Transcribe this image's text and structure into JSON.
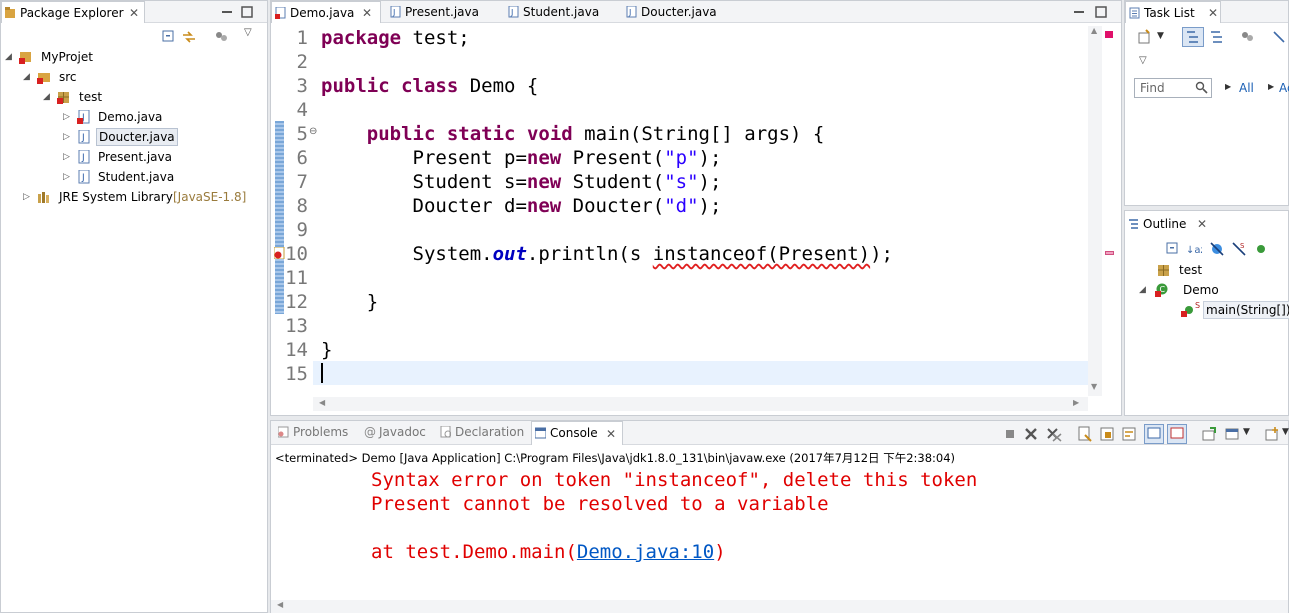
{
  "package_explorer": {
    "title": "Package Explorer",
    "tree": [
      {
        "label": "MyProjet"
      },
      {
        "label": "src"
      },
      {
        "label": "test"
      },
      {
        "label": "Demo.java"
      },
      {
        "label": "Doucter.java"
      },
      {
        "label": "Present.java"
      },
      {
        "label": "Student.java"
      },
      {
        "label": "JRE System Library",
        "suffix": "[JavaSE-1.8]"
      }
    ]
  },
  "editor": {
    "tabs": [
      {
        "label": "Demo.java"
      },
      {
        "label": "Present.java"
      },
      {
        "label": "Student.java"
      },
      {
        "label": "Doucter.java"
      }
    ],
    "line_numbers": [
      "1",
      "2",
      "3",
      "4",
      "5",
      "6",
      "7",
      "8",
      "9",
      "10",
      "11",
      "12",
      "13",
      "14",
      "15"
    ],
    "code": {
      "l1_kw": "package",
      "l1_rest": " test;",
      "l3_kw1": "public",
      "l3_kw2": "class",
      "l3_rest": " Demo {",
      "l5_kw1": "public",
      "l5_kw2": "static",
      "l5_kw3": "void",
      "l5_rest": " main(String[] args) {",
      "l6_a": "Present p=",
      "l6_kw": "new",
      "l6_b": " Present(",
      "l6_str": "\"p\"",
      "l6_c": ");",
      "l7_a": "Student s=",
      "l7_kw": "new",
      "l7_b": " Student(",
      "l7_str": "\"s\"",
      "l7_c": ");",
      "l8_a": "Doucter d=",
      "l8_kw": "new",
      "l8_b": " Doucter(",
      "l8_str": "\"d\"",
      "l8_c": ");",
      "l10_a": "System.",
      "l10_fld": "out",
      "l10_b": ".println(s ",
      "l10_err": "instanceof(Present)",
      "l10_c": ");",
      "l12": "}",
      "l14": "}"
    }
  },
  "task_list": {
    "title": "Task List",
    "find_placeholder": "Find",
    "all_label": "All",
    "activate_label": "Ac"
  },
  "outline": {
    "title": "Outline",
    "items": [
      {
        "label": "test"
      },
      {
        "label": "Demo"
      },
      {
        "label": "main(String[])"
      }
    ]
  },
  "bottom_tabs": [
    {
      "label": "Problems"
    },
    {
      "label": "Javadoc"
    },
    {
      "label": "Declaration"
    },
    {
      "label": "Console"
    }
  ],
  "console": {
    "status": "<terminated> Demo [Java Application] C:\\Program Files\\Java\\jdk1.8.0_131\\bin\\javaw.exe (2017年7月12日 下午2:38:04)",
    "line1": "Syntax error on token \"instanceof\", delete this token",
    "line2": "Present cannot be resolved to a variable",
    "line3_prefix": "at test.Demo.main(",
    "line3_link": "Demo.java:10",
    "line3_suffix": ")"
  },
  "colors": {
    "keyword": "#7f0055",
    "string": "#2a00ff",
    "field": "#0000c0",
    "error": "#e00000",
    "link": "#0057c4"
  }
}
